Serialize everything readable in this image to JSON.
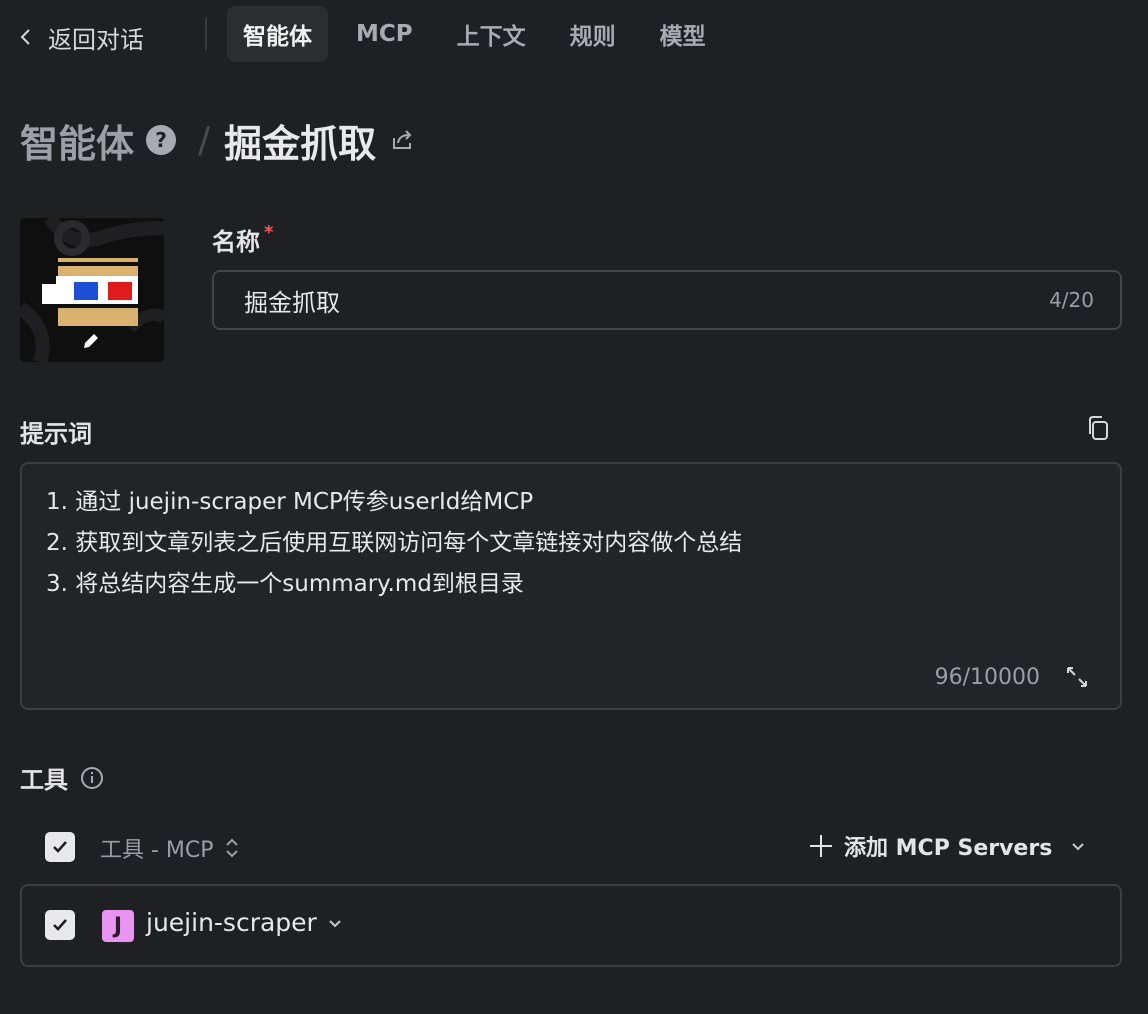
{
  "nav": {
    "back_label": "返回对话",
    "tabs": [
      {
        "label": "智能体",
        "active": true
      },
      {
        "label": "MCP",
        "active": false
      },
      {
        "label": "上下文",
        "active": false
      },
      {
        "label": "规则",
        "active": false
      },
      {
        "label": "模型",
        "active": false
      }
    ]
  },
  "breadcrumb": {
    "root": "智能体",
    "help_glyph": "?",
    "separator": "/",
    "current": "掘金抓取"
  },
  "name_field": {
    "label": "名称",
    "required_mark": "*",
    "value": "掘金抓取",
    "counter": "4/20"
  },
  "prompt": {
    "label": "提示词",
    "lines": [
      "1. 通过 juejin-scraper MCP传参userId给MCP",
      "2. 获取到文章列表之后使用互联网访问每个文章链接对内容做个总结",
      "3. 将总结内容生成一个summary.md到根目录"
    ],
    "counter": "96/10000"
  },
  "tools": {
    "title": "工具",
    "header_label": "工具 - MCP",
    "header_checked": true,
    "add_button": "添加 MCP Servers",
    "items": [
      {
        "badge": "J",
        "name": "juejin-scraper",
        "checked": true,
        "badge_color": "#e895f2"
      }
    ]
  },
  "icons": {
    "back": "chevron-left-icon",
    "help": "question-circle-icon",
    "share": "share-icon",
    "edit": "pencil-icon",
    "copy": "copy-icon",
    "expand": "expand-icon",
    "info": "info-icon",
    "sort": "sort-icon",
    "add": "plus-icon",
    "dropdown": "chevron-down-icon"
  }
}
